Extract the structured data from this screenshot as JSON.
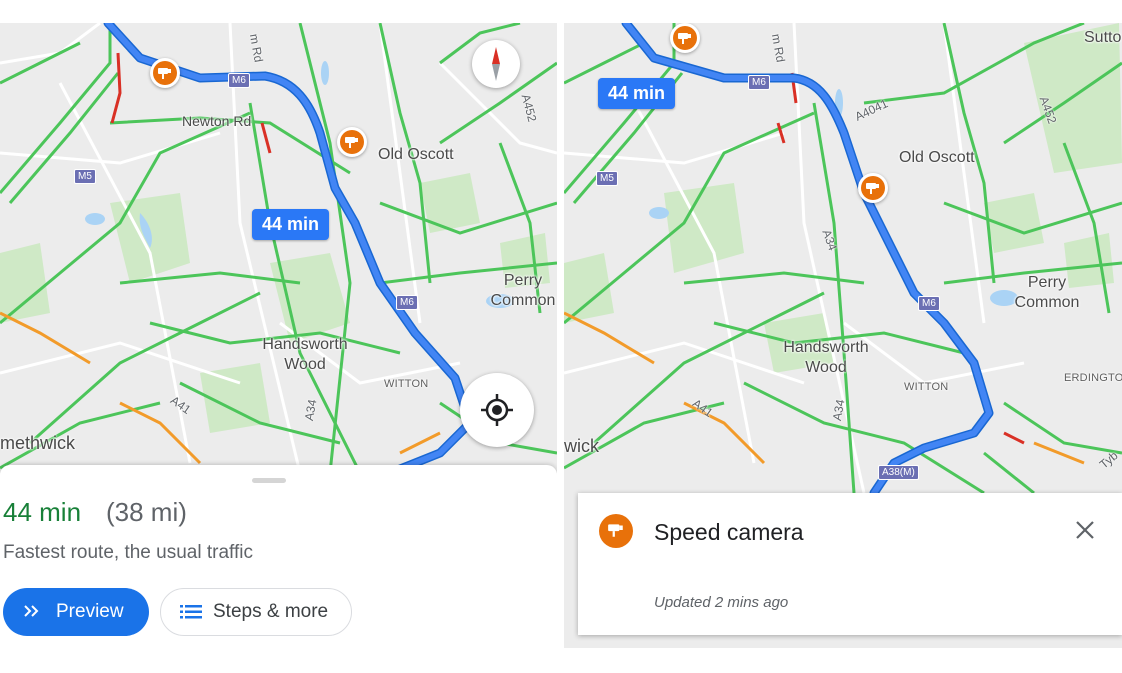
{
  "colors": {
    "route": "#4285f4",
    "traffic_free": "#4cc55a",
    "traffic_slow": "#f29b2a",
    "traffic_heavy": "#d93025",
    "camera": "#e8710a",
    "eta_badge": "#2a78f6",
    "duration_green": "#188038",
    "primary_button": "#1a73e8"
  },
  "left_map": {
    "eta_badge": "44 min",
    "place_labels": [
      "Newton Rd",
      "Old Oscott",
      "Perry Common",
      "Handsworth Wood",
      "WITTON",
      "methwick"
    ],
    "road_labels": [
      "M6",
      "M5",
      "A452",
      "A41",
      "A34",
      "m Rd",
      "A38(M)"
    ],
    "icons": [
      "speed-camera-pin",
      "compass-icon",
      "my-location-icon"
    ]
  },
  "route_sheet": {
    "duration": "44 min",
    "distance": "(38 mi)",
    "description": "Fastest route, the usual traffic",
    "preview_label": "Preview",
    "steps_label": "Steps & more"
  },
  "right_map": {
    "eta_badge": "44 min",
    "place_labels": [
      "Sutto",
      "Old Oscott",
      "Perry Common",
      "Handsworth Wood",
      "WITTON",
      "ERDINGTO",
      "wick"
    ],
    "road_labels": [
      "M6",
      "M5",
      "A4041",
      "A452",
      "A34",
      "A41",
      "A38(M)",
      "m Rd",
      "Tyb"
    ]
  },
  "camera_card": {
    "title": "Speed camera",
    "updated": "Updated 2 mins ago",
    "close_icon": "close-icon"
  }
}
